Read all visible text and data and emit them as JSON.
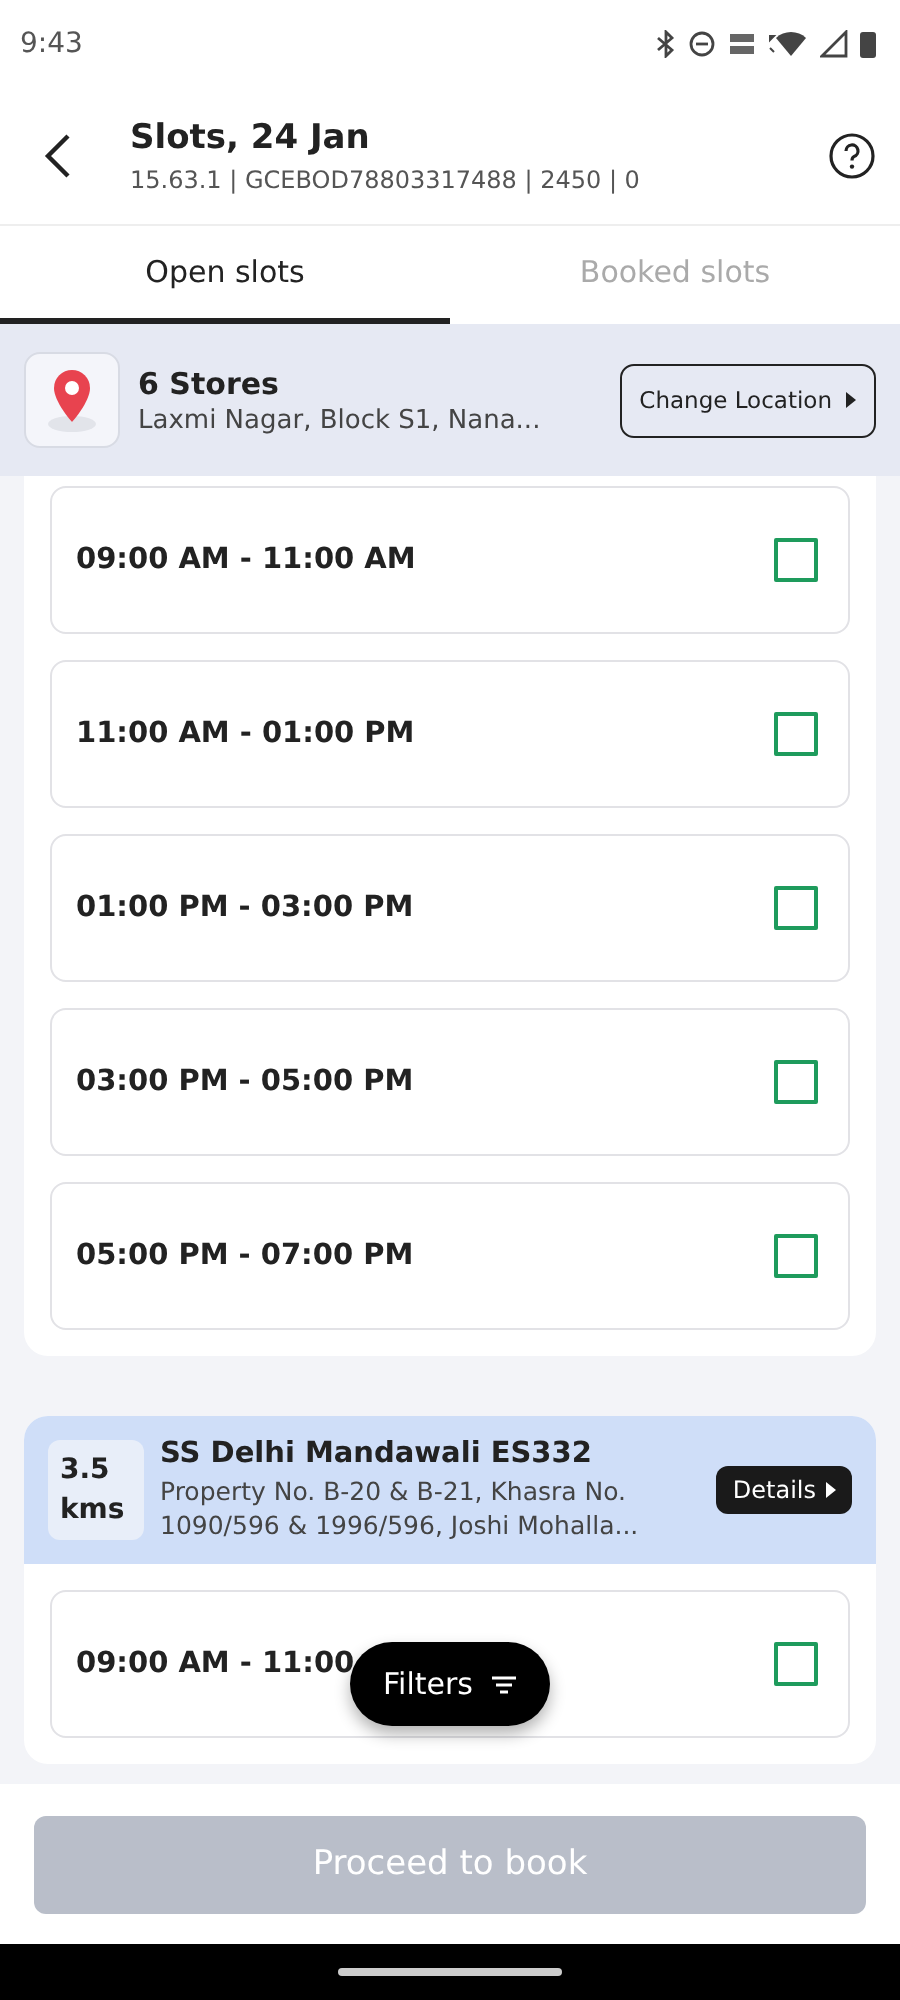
{
  "status_bar": {
    "time": "9:43"
  },
  "header": {
    "title": "Slots, 24 Jan",
    "subtitle": "15.63.1 | GCEBOD78803317488 | 2450 | 0"
  },
  "tabs": [
    {
      "label": "Open slots",
      "selected": true
    },
    {
      "label": "Booked slots",
      "selected": false
    }
  ],
  "location": {
    "title": "6 Stores",
    "address": "Laxmi Nagar, Block S1, Nana...",
    "button": "Change Location"
  },
  "store_groups": [
    {
      "slots": [
        {
          "time": "09:00 AM - 11:00 AM",
          "checked": false
        },
        {
          "time": "11:00 AM - 01:00 PM",
          "checked": false
        },
        {
          "time": "01:00 PM - 03:00 PM",
          "checked": false
        },
        {
          "time": "03:00 PM - 05:00 PM",
          "checked": false
        },
        {
          "time": "05:00 PM - 07:00 PM",
          "checked": false
        }
      ]
    },
    {
      "distance": "3.5 kms",
      "name": "SS Delhi Mandawali ES332",
      "address": "Property No. B-20 & B-21, Khasra No. 1090/596 & 1996/596, Joshi Mohalla...",
      "details_button": "Details",
      "slots": [
        {
          "time": "09:00 AM - 11:00",
          "checked": false
        }
      ]
    }
  ],
  "filters_button": "Filters",
  "proceed_button": {
    "label": "Proceed to book",
    "disabled": true
  }
}
